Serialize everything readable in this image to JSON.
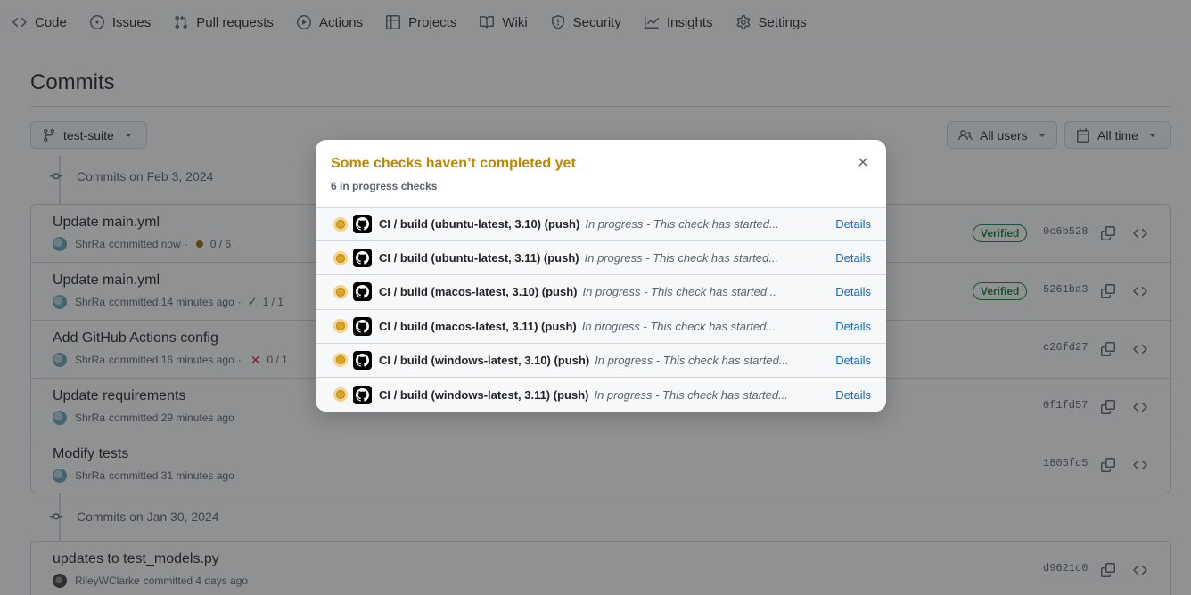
{
  "nav": {
    "items": [
      {
        "label": "Code",
        "icon": "code-icon"
      },
      {
        "label": "Issues",
        "icon": "issue-opened-icon"
      },
      {
        "label": "Pull requests",
        "icon": "git-pull-request-icon"
      },
      {
        "label": "Actions",
        "icon": "play-icon"
      },
      {
        "label": "Projects",
        "icon": "table-icon"
      },
      {
        "label": "Wiki",
        "icon": "book-icon"
      },
      {
        "label": "Security",
        "icon": "shield-icon"
      },
      {
        "label": "Insights",
        "icon": "graph-icon"
      },
      {
        "label": "Settings",
        "icon": "gear-icon"
      }
    ]
  },
  "page": {
    "title": "Commits",
    "branch": "test-suite",
    "users_filter": "All users",
    "time_filter": "All time"
  },
  "groups": [
    {
      "header": "Commits on Feb 3, 2024",
      "commits": [
        {
          "title": "Update main.yml",
          "author": "ShrRa",
          "time": "committed now",
          "status": "pending",
          "status_text": "0 / 6",
          "verified": "Verified",
          "sha": "0c6b528"
        },
        {
          "title": "Update main.yml",
          "author": "ShrRa",
          "time": "committed 14 minutes ago",
          "status": "success",
          "status_text": "1 / 1",
          "verified": "Verified",
          "sha": "5261ba3"
        },
        {
          "title": "Add GitHub Actions config",
          "author": "ShrRa",
          "time": "committed 16 minutes ago",
          "status": "failure",
          "status_text": "0 / 1",
          "verified": "",
          "sha": "c26fd27"
        },
        {
          "title": "Update requirements",
          "author": "ShrRa",
          "time": "committed 29 minutes ago",
          "status": "",
          "status_text": "",
          "verified": "",
          "sha": "0f1fd57"
        },
        {
          "title": "Modify tests",
          "author": "ShrRa",
          "time": "committed 31 minutes ago",
          "status": "",
          "status_text": "",
          "verified": "",
          "sha": "1805fd5"
        }
      ]
    },
    {
      "header": "Commits on Jan 30, 2024",
      "commits": [
        {
          "title": "updates to test_models.py",
          "author": "RileyWClarke",
          "time": "committed 4 days ago",
          "status": "",
          "status_text": "",
          "verified": "",
          "sha": "d9621c0"
        }
      ]
    }
  ],
  "modal": {
    "title": "Some checks haven’t completed yet",
    "subtitle": "6 in progress checks",
    "title_color": "#bf8700",
    "checks": [
      {
        "name": "CI / build (ubuntu-latest, 3.10) (push)",
        "description": "In progress - This check has started...",
        "link": "Details"
      },
      {
        "name": "CI / build (ubuntu-latest, 3.11) (push)",
        "description": "In progress - This check has started...",
        "link": "Details"
      },
      {
        "name": "CI / build (macos-latest, 3.10) (push)",
        "description": "In progress - This check has started...",
        "link": "Details"
      },
      {
        "name": "CI / build (macos-latest, 3.11) (push)",
        "description": "In progress - This check has started...",
        "link": "Details"
      },
      {
        "name": "CI / build (windows-latest, 3.10) (push)",
        "description": "In progress - This check has started...",
        "link": "Details"
      },
      {
        "name": "CI / build (windows-latest, 3.11) (push)",
        "description": "In progress - This check has started...",
        "link": "Details"
      }
    ]
  }
}
